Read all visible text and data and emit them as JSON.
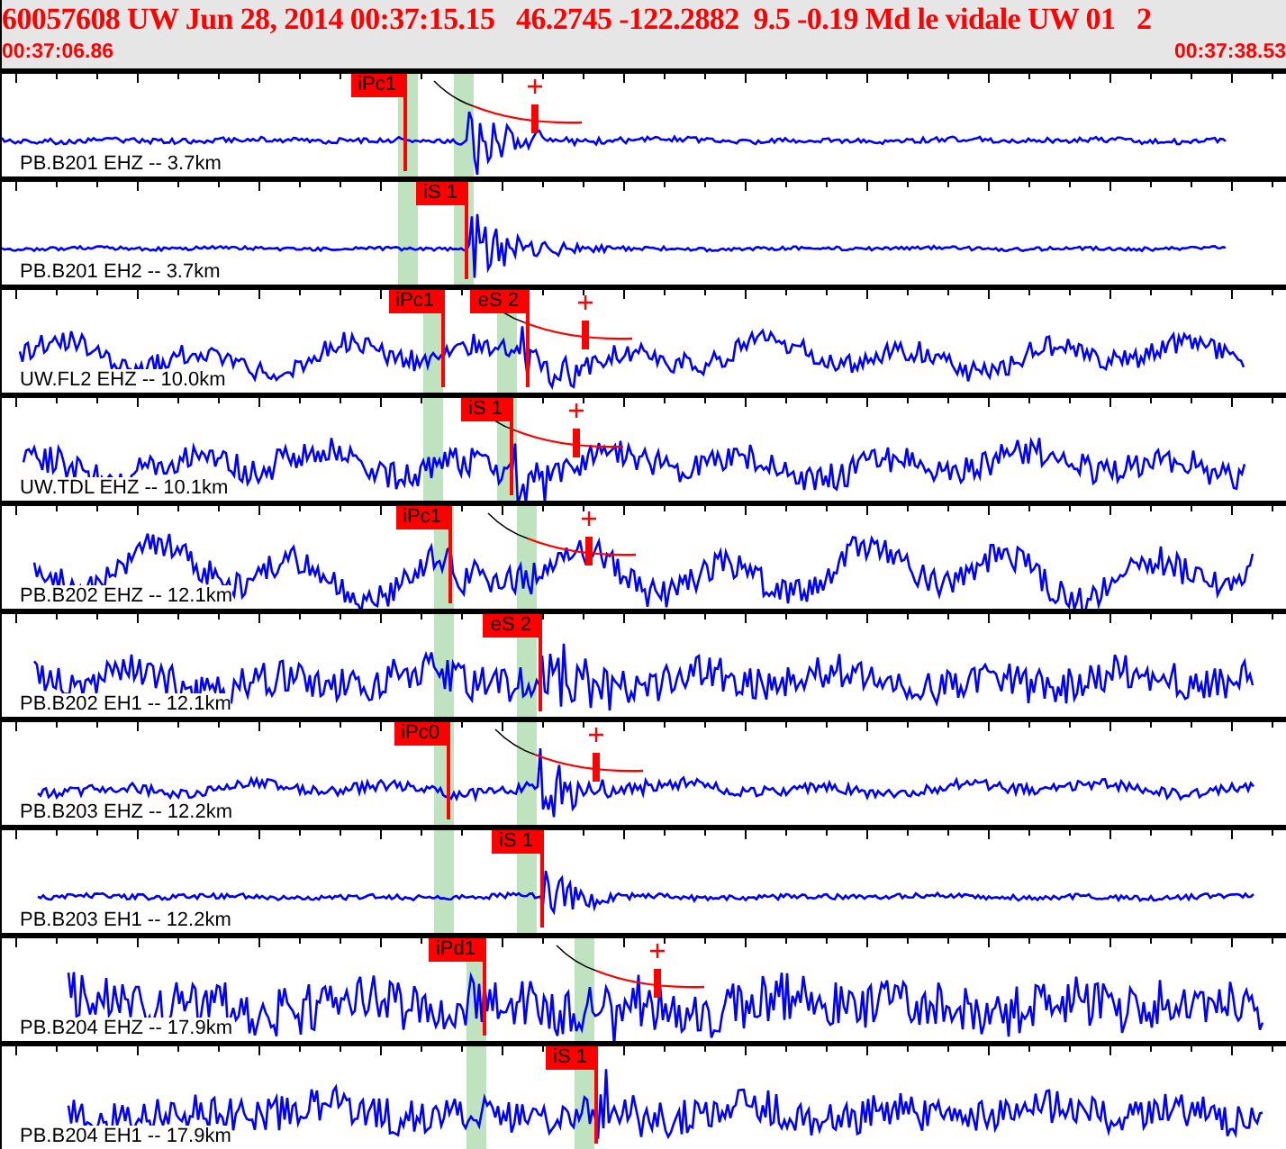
{
  "header": {
    "title": "60057608 UW Jun 28, 2014 00:37:15.15   46.2745 -122.2882  9.5 -0.19 Md le vidale UW 01   2",
    "start_time": "00:37:06.86",
    "end_time": "00:37:38.53"
  },
  "traces": [
    {
      "label": "PB.B201 EHZ -- 3.7km",
      "picks": [
        {
          "label": "iPc1"
        }
      ]
    },
    {
      "label": "PB.B201 EH2 -- 3.7km",
      "picks": [
        {
          "label": "iS 1"
        }
      ]
    },
    {
      "label": "UW.FL2 EHZ -- 10.0km",
      "picks": [
        {
          "label": "iPc1"
        },
        {
          "label": "eS 2"
        }
      ]
    },
    {
      "label": "UW.TDL EHZ -- 10.1km",
      "picks": [
        {
          "label": "iS 1"
        }
      ]
    },
    {
      "label": "PB.B202 EHZ -- 12.1km",
      "picks": [
        {
          "label": "iPc1"
        }
      ]
    },
    {
      "label": "PB.B202 EH1 -- 12.1km",
      "picks": [
        {
          "label": "eS 2"
        }
      ]
    },
    {
      "label": "PB.B203 EHZ -- 12.2km",
      "picks": [
        {
          "label": "iPc0"
        }
      ]
    },
    {
      "label": "PB.B203 EH1 -- 12.2km",
      "picks": [
        {
          "label": "iS 1"
        }
      ]
    },
    {
      "label": "PB.B204 EHZ -- 17.9km",
      "picks": [
        {
          "label": "iPd1"
        }
      ]
    },
    {
      "label": "PB.B204 EH1 -- 17.9km",
      "picks": [
        {
          "label": "iS 1"
        }
      ]
    }
  ]
}
